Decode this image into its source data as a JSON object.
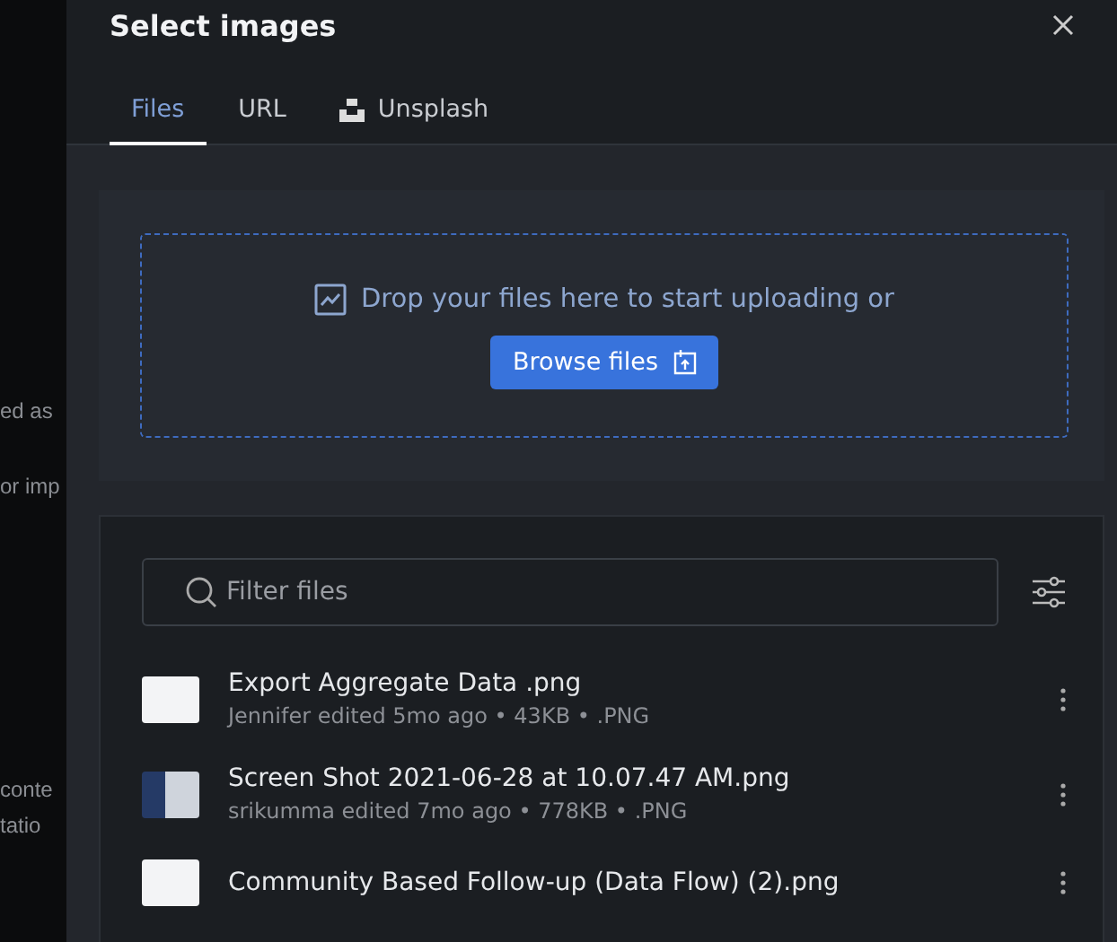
{
  "background_text": [
    "ed as",
    "or imp",
    "conte",
    "tatio"
  ],
  "dialog": {
    "title": "Select images"
  },
  "tabs": [
    {
      "label": "Files",
      "selected": true,
      "kind": "plain"
    },
    {
      "label": "URL",
      "selected": false,
      "kind": "plain"
    },
    {
      "label": "Unsplash",
      "selected": false,
      "kind": "unsplash"
    }
  ],
  "dropzone": {
    "text": "Drop your files here to start uploading or",
    "button": "Browse files"
  },
  "filter": {
    "placeholder": "Filter files"
  },
  "files": [
    {
      "name": "Export Aggregate Data .png",
      "meta": "Jennifer edited 5mo ago • 43KB • .PNG",
      "kind": "light"
    },
    {
      "name": "Screen Shot 2021-06-28 at 10.07.47 AM.png",
      "meta": "srikumma edited 7mo ago • 778KB • .PNG",
      "kind": "dark"
    },
    {
      "name": "Community Based Follow-up (Data Flow) (2).png",
      "kind": "light"
    }
  ]
}
